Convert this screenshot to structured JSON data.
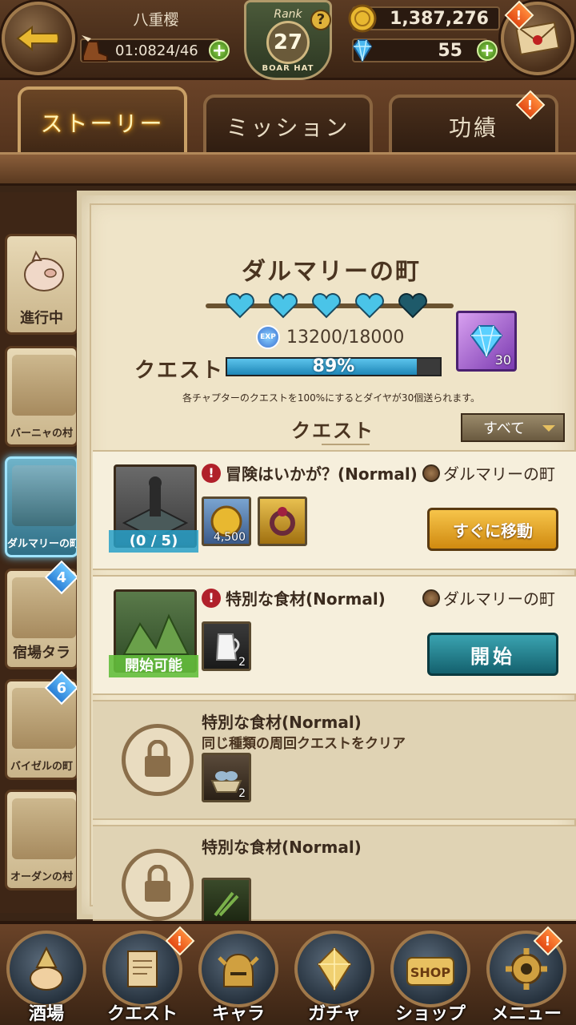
{
  "header": {
    "player_name": "八重樱",
    "timer": "01:08",
    "stamina": "24/46",
    "gold": "1,387,276",
    "gems": "55",
    "rank_label": "Rank",
    "rank": "27",
    "rank_emblem_text": "BOAR HAT",
    "alert_mark": "!",
    "help_mark": "?",
    "plus_mark": "+"
  },
  "tabs": [
    {
      "label": "ストーリー",
      "active": true
    },
    {
      "label": "ミッション",
      "active": false
    },
    {
      "label": "功績",
      "active": false
    }
  ],
  "sidebar": {
    "chapters": [
      {
        "label": "進行中",
        "active": false,
        "badge": null
      },
      {
        "label": "バーニャの村",
        "active": false,
        "badge": null
      },
      {
        "label": "ダルマリーの町",
        "active": true,
        "badge": null
      },
      {
        "label": "宿場タラ",
        "active": false,
        "badge": "4"
      },
      {
        "label": "バイゼルの町",
        "active": false,
        "badge": "6"
      },
      {
        "label": "オーダンの村",
        "active": false,
        "badge": null
      }
    ]
  },
  "chapter": {
    "title": "ダルマリーの町",
    "hearts_filled": 4,
    "hearts_total": 5,
    "exp_icon": "EXP",
    "exp": "13200/18000",
    "quest_label": "クエスト",
    "progress_text": "89%",
    "progress_value": 0.89,
    "reward_count": "30",
    "notice": "各チャプターのクエストを100%にするとダイヤが30個送られます。",
    "list_title": "クエスト",
    "filter": "すべて"
  },
  "quests": [
    {
      "title": "冒険はいかが？(Normal)",
      "location": "ダルマリーの町",
      "state": "(0 / 5)",
      "items": [
        {
          "icon": "gold-coin-icon",
          "count": "4,500"
        },
        {
          "icon": "ring-icon",
          "count": ""
        }
      ],
      "button": "すぐに移動"
    },
    {
      "title": "特別な食材(Normal)",
      "location": "ダルマリーの町",
      "state": "開始可能",
      "items": [
        {
          "icon": "milk-jug-icon",
          "count": "2"
        }
      ],
      "button": "開始"
    },
    {
      "title": "特別な食材(Normal)",
      "subtitle": "同じ種類の周回クエストをクリア",
      "items": [
        {
          "icon": "fish-basket-icon",
          "count": "2"
        }
      ]
    },
    {
      "title": "特別な食材(Normal)",
      "items": [
        {
          "icon": "herb-icon",
          "count": ""
        }
      ]
    }
  ],
  "bottom_nav": [
    {
      "label": "酒場",
      "icon": "tavern-pig-icon",
      "alert": false
    },
    {
      "label": "クエスト",
      "icon": "quest-scroll-icon",
      "alert": true
    },
    {
      "label": "キャラ",
      "icon": "helmet-icon",
      "alert": false
    },
    {
      "label": "ガチャ",
      "icon": "crystal-icon",
      "alert": false
    },
    {
      "label": "ショップ",
      "icon": "shop-sign-icon",
      "alert": false
    },
    {
      "label": "メニュー",
      "icon": "gear-icon",
      "alert": true
    }
  ],
  "shop_sign_text": "SHOP",
  "colors": {
    "wood_dark": "#3a2516",
    "parchment": "#efe4c8",
    "accent_teal": "#1e86b6",
    "button_gold": "#d08a10",
    "alert_orange": "#e34a14"
  }
}
